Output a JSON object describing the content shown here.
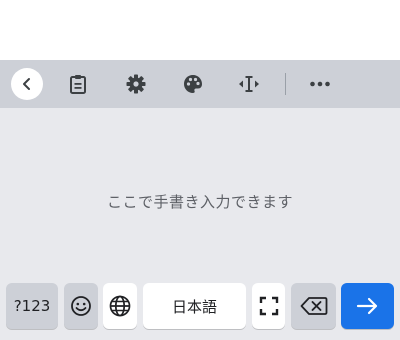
{
  "toolbar": {
    "icons": [
      "back-icon",
      "clipboard-icon",
      "gear-icon",
      "palette-icon",
      "cursor-resize-icon",
      "more-icon"
    ]
  },
  "canvas": {
    "hint": "ここで手書き入力できます"
  },
  "keys": {
    "numbers": "?123",
    "language": "日本語"
  },
  "colors": {
    "toolbar_bg": "#cdd0d7",
    "canvas_bg": "#e8e9ed",
    "enter_bg": "#1a73e8",
    "icon": "#3c4043"
  }
}
